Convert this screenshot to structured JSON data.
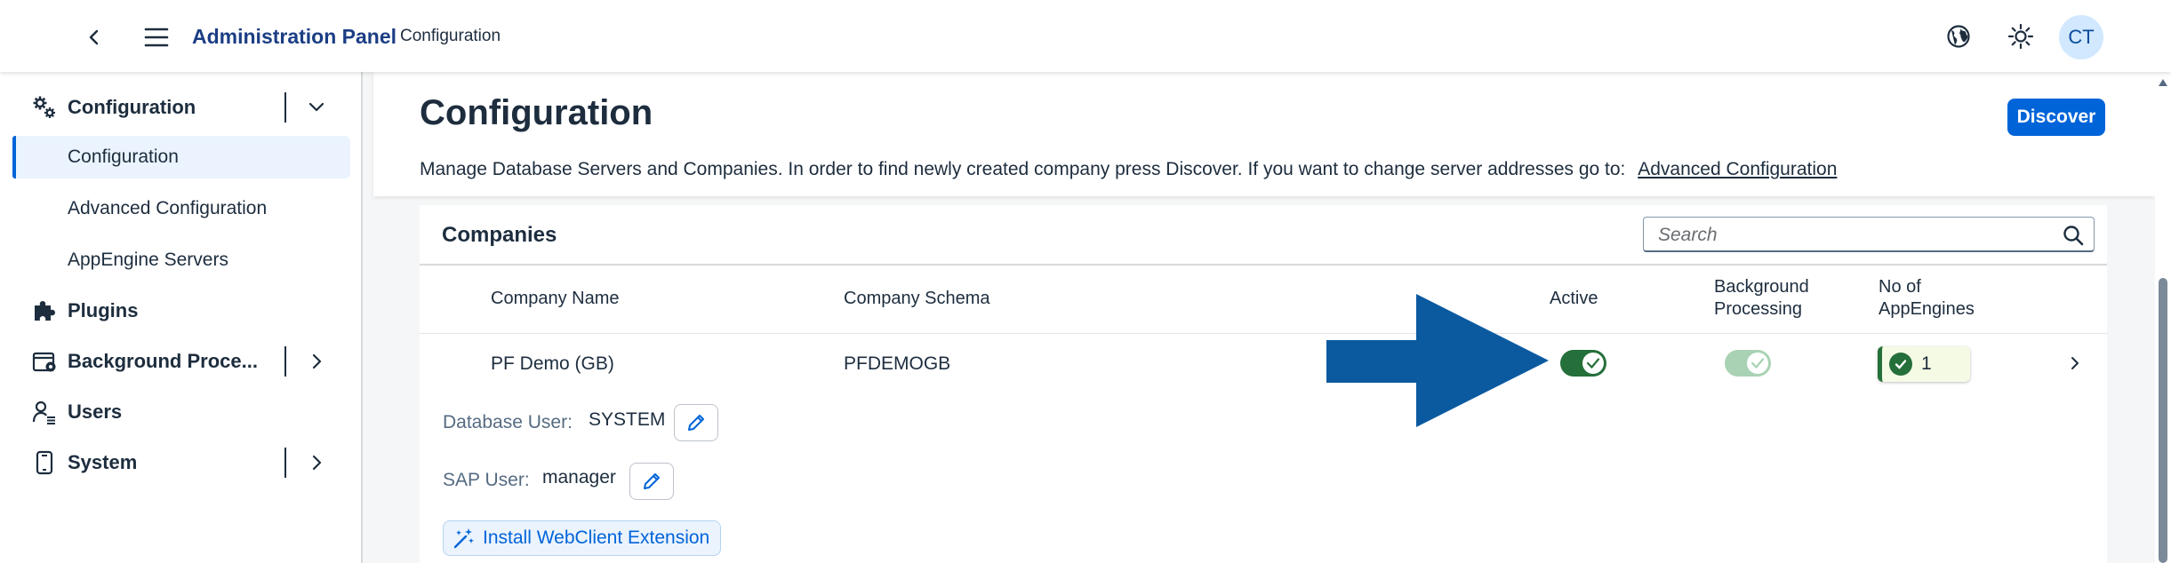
{
  "shell": {
    "title": "Administration Panel",
    "subtitle": "Configuration",
    "avatar_initials": "CT",
    "icons": [
      "back-icon",
      "menu-icon",
      "globe-icon",
      "theme-icon"
    ]
  },
  "sidebar": {
    "items": [
      {
        "label": "Configuration",
        "icon": "gears-icon",
        "expanded": true,
        "children": [
          {
            "label": "Configuration",
            "selected": true
          },
          {
            "label": "Advanced Configuration",
            "selected": false
          },
          {
            "label": "AppEngine Servers",
            "selected": false
          }
        ]
      },
      {
        "label": "Plugins",
        "icon": "puzzle-icon"
      },
      {
        "label": "Background Proce...",
        "icon": "background-processing-icon",
        "expandable": true
      },
      {
        "label": "Users",
        "icon": "users-icon"
      },
      {
        "label": "System",
        "icon": "device-icon",
        "expandable": true
      }
    ]
  },
  "page": {
    "title": "Configuration",
    "discover_label": "Discover",
    "description": "Manage Database Servers and Companies. In order to find newly created company press Discover. If you want to change server addresses go to:",
    "advanced_link": "Advanced Configuration"
  },
  "companies": {
    "title": "Companies",
    "search_placeholder": "Search",
    "columns": [
      "Company Name",
      "Company Schema",
      "Active",
      "Background Processing",
      "No of AppEngines"
    ],
    "columns_wrapped": {
      "background": [
        "Background",
        "Processing"
      ],
      "appengines": [
        "No of",
        "AppEngines"
      ]
    },
    "rows": [
      {
        "company_name": "PF Demo (GB)",
        "company_schema": "PFDEMOGB",
        "active": true,
        "background_processing": true,
        "appengines": "1",
        "database_user_label": "Database User:",
        "database_user": "SYSTEM",
        "sap_user_label": "SAP User:",
        "sap_user": "manager",
        "install_extension_label": "Install WebClient Extension"
      }
    ]
  },
  "colors": {
    "brand": "#1b3e84",
    "accent": "#0064d9",
    "positive": "#256f3a",
    "annotation_arrow": "#0b5aa0"
  }
}
